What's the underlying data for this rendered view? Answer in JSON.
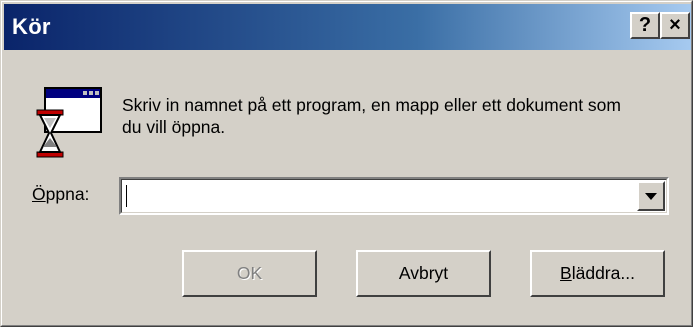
{
  "window": {
    "title": "Kör",
    "help_button": "?",
    "close_button": "×"
  },
  "description": "Skriv in namnet på ett program, en mapp eller ett dokument som du vill öppna.",
  "open_field": {
    "label_mnemonic": "Ö",
    "label_rest": "ppna:",
    "value": "",
    "placeholder": ""
  },
  "buttons": {
    "ok": "OK",
    "cancel": "Avbryt",
    "browse_mnemonic": "B",
    "browse_rest": "läddra..."
  },
  "icons": {
    "app": "run-program-icon",
    "dropdown": "chevron-down-icon"
  },
  "colors": {
    "title_start": "#0a246a",
    "title_end": "#a6caf0",
    "face": "#d4d0c8",
    "disabled_text": "#808080"
  }
}
